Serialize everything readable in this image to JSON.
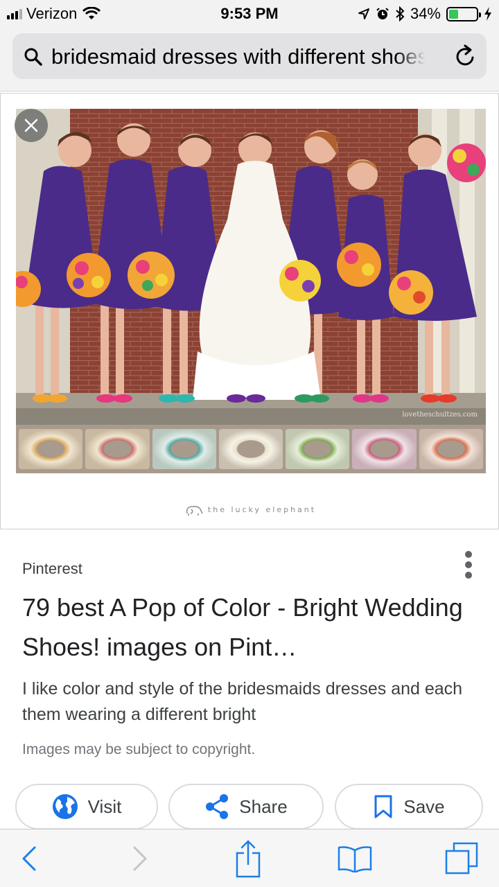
{
  "status_bar": {
    "carrier": "Verizon",
    "time": "9:53 PM",
    "battery_percent": "34%",
    "battery_level": 0.34,
    "icons": [
      "signal-icon",
      "wifi-icon",
      "location-icon",
      "alarm-icon",
      "bluetooth-icon",
      "battery-icon",
      "charging-icon"
    ]
  },
  "address_bar": {
    "query": "bridesmaid dresses with different shoes",
    "icons": [
      "search-icon",
      "reload-icon"
    ]
  },
  "image": {
    "watermark": "lovetheschultzes.com",
    "caption": "the lucky elephant",
    "icons": [
      "close-icon",
      "elephant-icon"
    ]
  },
  "result": {
    "source": "Pinterest",
    "title": "79 best A Pop of Color - Bright Wedding Shoes! images on Pint…",
    "description": "I like color and style of the bridesmaids dresses and each them wearing a different bright",
    "copyright": "Images may be subject to copyright."
  },
  "actions": {
    "visit": "Visit",
    "share": "Share",
    "save": "Save"
  },
  "colors": {
    "accent": "#1a73e8",
    "dress": "#4a2b8a",
    "battery": "#34c759"
  }
}
